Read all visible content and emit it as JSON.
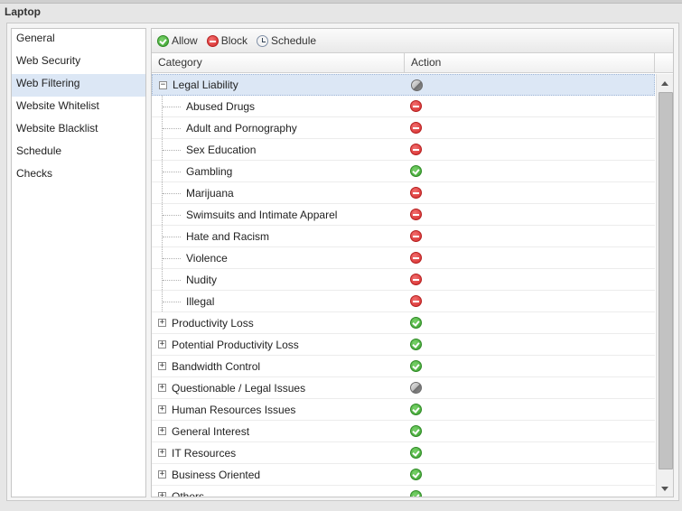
{
  "window": {
    "title": "Laptop"
  },
  "nav": {
    "items": [
      {
        "label": "General",
        "active": false
      },
      {
        "label": "Web Security",
        "active": false
      },
      {
        "label": "Web Filtering",
        "active": true
      },
      {
        "label": "Website Whitelist",
        "active": false
      },
      {
        "label": "Website Blacklist",
        "active": false
      },
      {
        "label": "Schedule",
        "active": false
      },
      {
        "label": "Checks",
        "active": false
      }
    ]
  },
  "toolbar": {
    "allow_label": "Allow",
    "block_label": "Block",
    "schedule_label": "Schedule",
    "allow_icon": "check-circle-icon",
    "block_icon": "minus-circle-icon",
    "schedule_icon": "clock-icon"
  },
  "grid": {
    "columns": {
      "category": "Category",
      "action": "Action"
    },
    "rows": [
      {
        "label": "Legal Liability",
        "level": 0,
        "expanded": true,
        "action": "mixed",
        "selected": true
      },
      {
        "label": "Abused Drugs",
        "level": 1,
        "action": "block"
      },
      {
        "label": "Adult and Pornography",
        "level": 1,
        "action": "block"
      },
      {
        "label": "Sex Education",
        "level": 1,
        "action": "block"
      },
      {
        "label": "Gambling",
        "level": 1,
        "action": "allow"
      },
      {
        "label": "Marijuana",
        "level": 1,
        "action": "block"
      },
      {
        "label": "Swimsuits and Intimate Apparel",
        "level": 1,
        "action": "block"
      },
      {
        "label": "Hate and Racism",
        "level": 1,
        "action": "block"
      },
      {
        "label": "Violence",
        "level": 1,
        "action": "block"
      },
      {
        "label": "Nudity",
        "level": 1,
        "action": "block"
      },
      {
        "label": "Illegal",
        "level": 1,
        "action": "block"
      },
      {
        "label": "Productivity Loss",
        "level": 0,
        "expanded": false,
        "action": "allow"
      },
      {
        "label": "Potential Productivity Loss",
        "level": 0,
        "expanded": false,
        "action": "allow"
      },
      {
        "label": "Bandwidth Control",
        "level": 0,
        "expanded": false,
        "action": "allow"
      },
      {
        "label": "Questionable / Legal Issues",
        "level": 0,
        "expanded": false,
        "action": "mixed"
      },
      {
        "label": "Human Resources Issues",
        "level": 0,
        "expanded": false,
        "action": "allow"
      },
      {
        "label": "General Interest",
        "level": 0,
        "expanded": false,
        "action": "allow"
      },
      {
        "label": "IT Resources",
        "level": 0,
        "expanded": false,
        "action": "allow"
      },
      {
        "label": "Business Oriented",
        "level": 0,
        "expanded": false,
        "action": "allow"
      },
      {
        "label": "Others",
        "level": 0,
        "expanded": false,
        "action": "allow"
      }
    ]
  },
  "colors": {
    "allow": "#3a9f2e",
    "block": "#d42a2a",
    "mixed": "#8f8f8f",
    "selection": "#dce7f5"
  }
}
